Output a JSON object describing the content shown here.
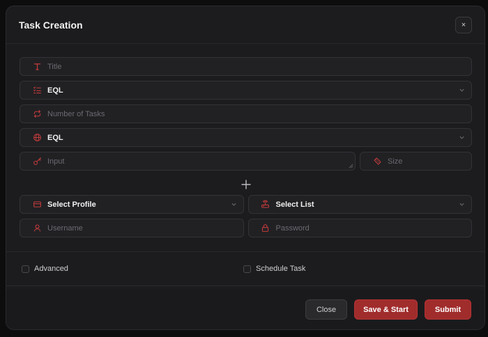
{
  "modal": {
    "title": "Task Creation",
    "close_icon": "×"
  },
  "fields": {
    "title": {
      "placeholder": "Title",
      "icon": "type-icon"
    },
    "mode": {
      "value": "EQL",
      "icon": "list-icon"
    },
    "num_tasks": {
      "placeholder": "Number of Tasks",
      "icon": "repeat-icon"
    },
    "region": {
      "value": "EQL",
      "icon": "globe-icon"
    },
    "input": {
      "placeholder": "Input",
      "icon": "key-icon"
    },
    "size": {
      "placeholder": "Size",
      "icon": "ruler-icon"
    },
    "profile": {
      "value": "Select Profile",
      "icon": "credit-card-icon"
    },
    "list": {
      "value": "Select List",
      "icon": "router-icon"
    },
    "username": {
      "placeholder": "Username",
      "icon": "user-icon"
    },
    "password": {
      "placeholder": "Password",
      "icon": "lock-icon"
    }
  },
  "options": {
    "advanced": "Advanced",
    "schedule": "Schedule Task"
  },
  "buttons": {
    "close": "Close",
    "save_start": "Save & Start",
    "submit": "Submit"
  },
  "colors": {
    "accent": "#a12c2c",
    "icon_red": "#c43b3b",
    "background": "#1c1c1e"
  }
}
